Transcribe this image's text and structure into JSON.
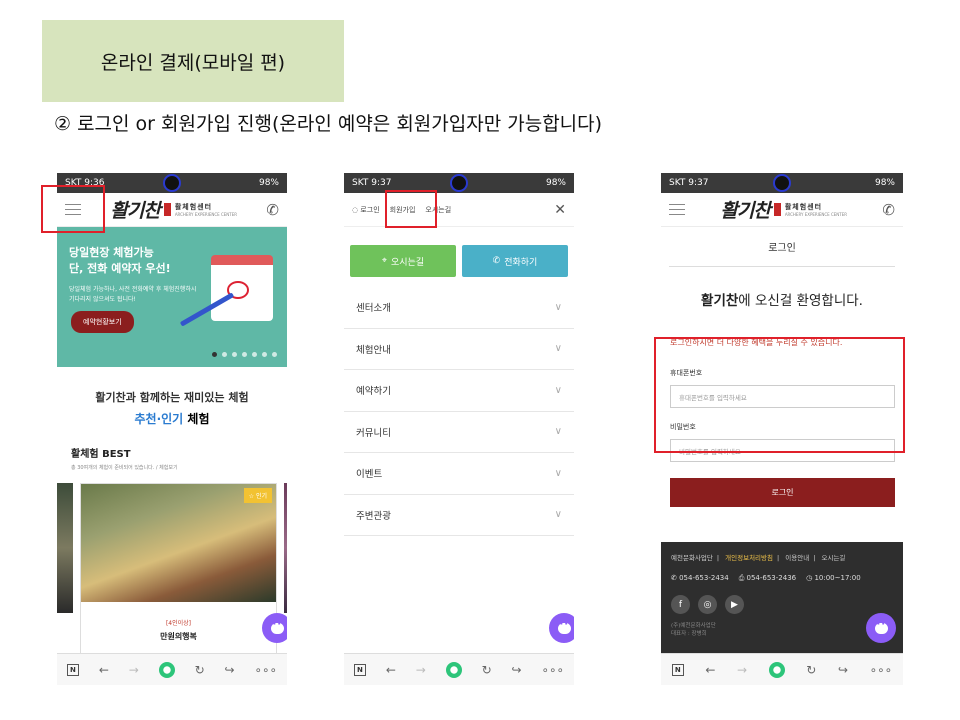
{
  "slide": {
    "title": "온라인 결제(모바일 편)",
    "subtitle": "② 로그인 or 회원가입 진행(온라인 예약은 회원가입자만 가능합니다)"
  },
  "status": {
    "carrier_time_1": "SKT 9:36",
    "carrier_time_2": "SKT 9:37",
    "carrier_time_3": "SKT 9:37",
    "battery": "98%"
  },
  "brand": {
    "logo_text": "활기찬",
    "center_name": "활체험센터",
    "center_sub": "ARCHERY EXPERIENCE CENTER"
  },
  "home": {
    "banner_title_1": "당일현장 체험가능",
    "banner_title_2": "단, 전화 예약자 우선!",
    "banner_desc_1": "당일체험 가능하나, 사전 전화예약 후 체험진행하시",
    "banner_desc_2": "기다리지 않으셔도 됩니다!",
    "banner_button": "예약현황보기",
    "intro_line1": "활기찬과 함께하는 재미있는 체험",
    "intro_hl": "추천·인기",
    "intro_rest": " 체험",
    "best_title": "활체험 BEST",
    "best_sub": "총 30여개의 체험이 준비되어 있습니다. / 체험보기",
    "card_badge": "☆ 인기",
    "card_tag": "[4인이상]",
    "card_name": "만원의행복"
  },
  "menu": {
    "top_login": "◌ 로그인",
    "top_signup": "회원가입",
    "top_directions": "오시는길",
    "btn_directions": "오시는길",
    "btn_call": "전화하기",
    "items": [
      "센터소개",
      "체험안내",
      "예약하기",
      "커뮤니티",
      "이벤트",
      "주변관광"
    ]
  },
  "login": {
    "header": "로그인",
    "welcome_brand": "활기찬",
    "welcome_rest": "에 오신걸 환영합니다.",
    "benefit": "로그인하시면 더 다양한 혜택을 누리실 수 있습니다.",
    "phone_label": "휴대폰번호",
    "phone_placeholder": "휴대폰번호를 입력하세요",
    "pw_label": "비밀번호",
    "pw_placeholder": "비밀번호를 입력하세요",
    "button": "로그인"
  },
  "footer": {
    "link1": "예천문화사업단",
    "link2": "개인정보처리방침",
    "link3": "이용안내",
    "link4": "오시는길",
    "tel": "054-653-2434",
    "fax": "054-653-2436",
    "hours": "10:00~17:00",
    "small1": "(주)예천문화사업단",
    "small2": "대표자 : 장병희"
  },
  "colors": {
    "accent_red": "#e0202a",
    "brand_maroon": "#8b1e1e",
    "banner_teal": "#5fb8a6",
    "chat_purple": "#8b5cf6"
  }
}
